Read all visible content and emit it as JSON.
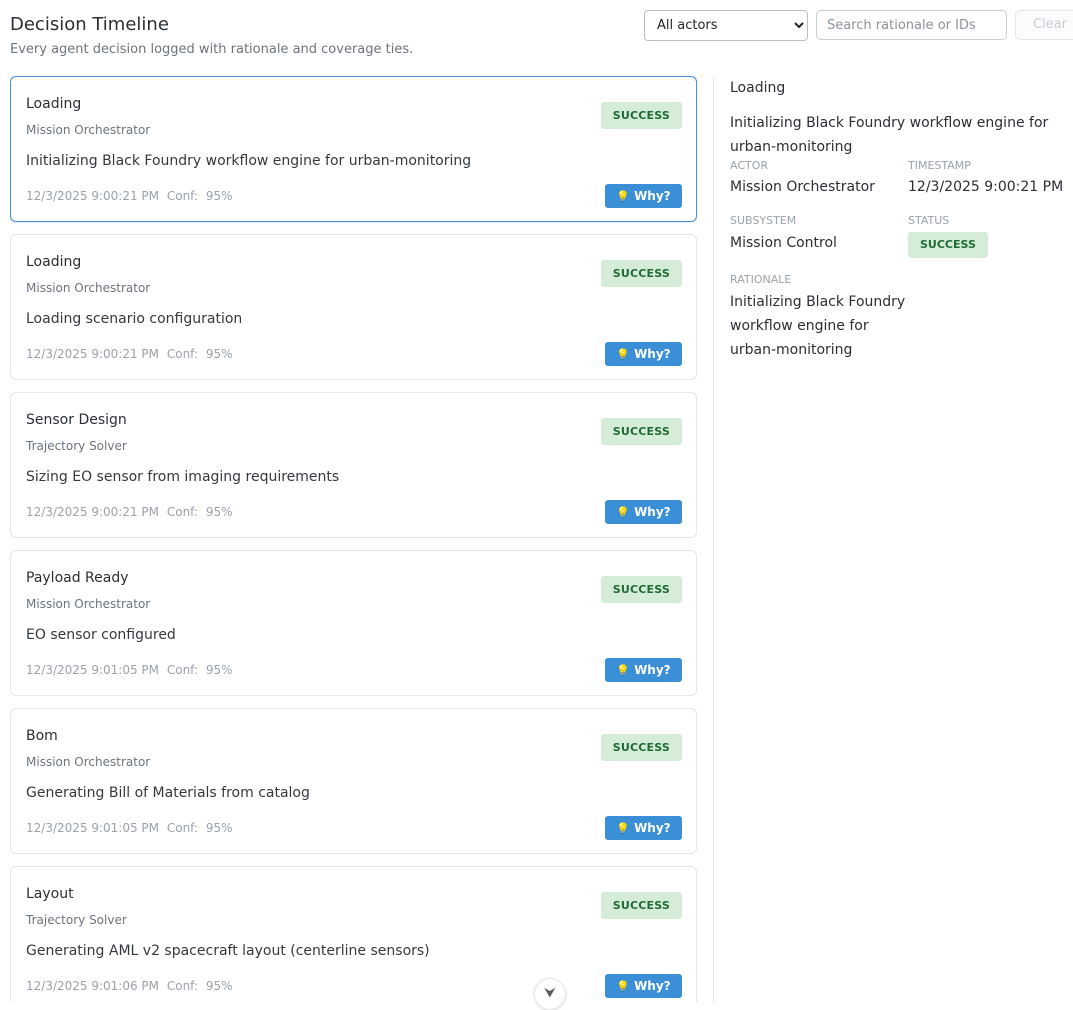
{
  "header": {
    "title": "Decision Timeline",
    "subtitle": "Every agent decision logged with rationale and coverage ties.",
    "actor_filter": "All actors",
    "search_placeholder": "Search rationale or IDs",
    "clear_label": "Clear"
  },
  "why_label": "Why?",
  "conf_prefix": "Conf:",
  "cards": [
    {
      "title": "Loading",
      "actor": "Mission Orchestrator",
      "text": "Initializing Black Foundry workflow engine for urban-monitoring",
      "timestamp": "12/3/2025 9:00:21 PM",
      "conf": "95%",
      "status": "SUCCESS"
    },
    {
      "title": "Loading",
      "actor": "Mission Orchestrator",
      "text": "Loading scenario configuration",
      "timestamp": "12/3/2025 9:00:21 PM",
      "conf": "95%",
      "status": "SUCCESS"
    },
    {
      "title": "Sensor Design",
      "actor": "Trajectory Solver",
      "text": "Sizing EO sensor from imaging requirements",
      "timestamp": "12/3/2025 9:00:21 PM",
      "conf": "95%",
      "status": "SUCCESS"
    },
    {
      "title": "Payload Ready",
      "actor": "Mission Orchestrator",
      "text": "EO sensor configured",
      "timestamp": "12/3/2025 9:01:05 PM",
      "conf": "95%",
      "status": "SUCCESS"
    },
    {
      "title": "Bom",
      "actor": "Mission Orchestrator",
      "text": "Generating Bill of Materials from catalog",
      "timestamp": "12/3/2025 9:01:05 PM",
      "conf": "95%",
      "status": "SUCCESS"
    },
    {
      "title": "Layout",
      "actor": "Trajectory Solver",
      "text": "Generating AML v2 spacecraft layout (centerline sensors)",
      "timestamp": "12/3/2025 9:01:06 PM",
      "conf": "95%",
      "status": "SUCCESS"
    }
  ],
  "detail": {
    "title": "Loading",
    "description": "Initializing Black Foundry workflow engine for urban-monitoring",
    "actor_label": "ACTOR",
    "actor": "Mission Orchestrator",
    "timestamp_label": "TIMESTAMP",
    "timestamp": "12/3/2025 9:00:21 PM",
    "subsystem_label": "SUBSYSTEM",
    "subsystem": "Mission Control",
    "status_label": "STATUS",
    "status": "SUCCESS",
    "rationale_label": "RATIONALE",
    "rationale": "Initializing Black Foundry workflow engine for urban-monitoring"
  },
  "icons": {
    "why": "lightbulb-icon",
    "scroll": "chevron-down-icon"
  },
  "colors": {
    "accent": "#3a8fd6",
    "success_bg": "#d5ecd9",
    "success_text": "#1f6b34",
    "selected_border": "#4a90d9"
  }
}
